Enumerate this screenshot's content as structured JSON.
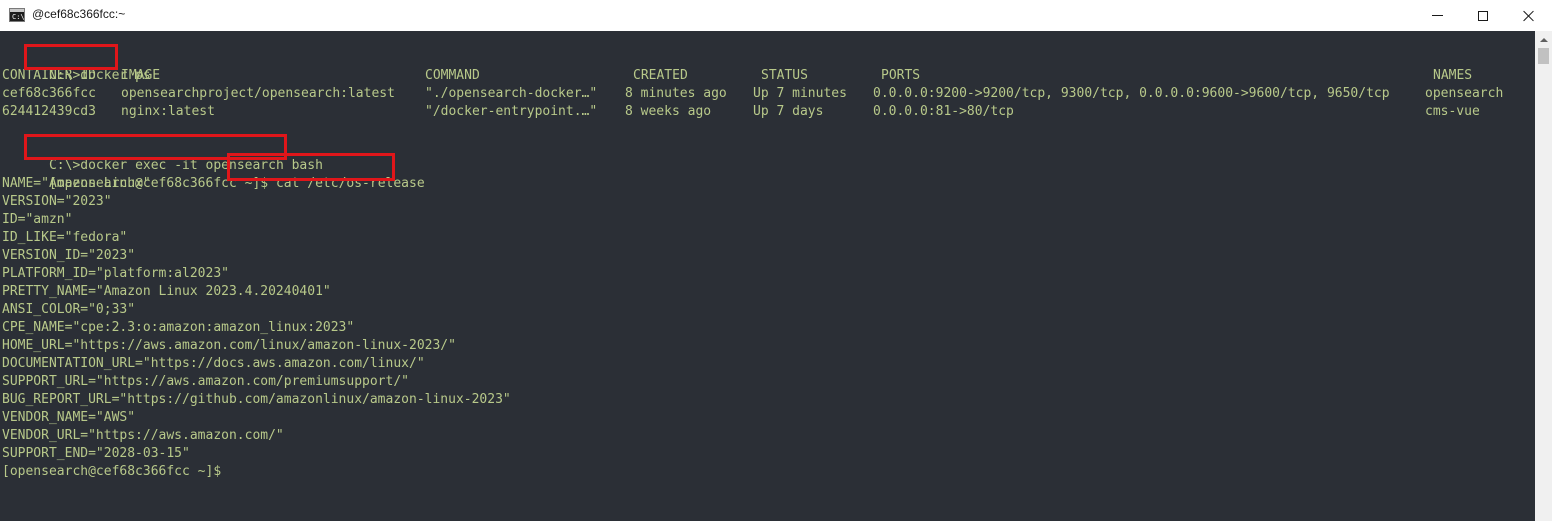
{
  "window": {
    "title": "@cef68c366fcc:~",
    "app_icon": "console-icon",
    "app_icon_glyph": "C:\\",
    "controls": {
      "minimize_icon": "minimize-icon",
      "maximize_icon": "maximize-icon",
      "close_icon": "close-icon"
    }
  },
  "terminal": {
    "colors": {
      "background": "#2b2f36",
      "text": "#b8c98a",
      "highlight_box": "#e0161a"
    },
    "commands": {
      "prompt1": "C:\\",
      "cmd1": ">docker ps",
      "prompt2": "C:\\",
      "cmd2": ">docker exec -it opensearch bash",
      "prompt3": "[opensearch@cef68c366fcc ~]$",
      "cmd3": " cat /etc/os-release",
      "final_prompt": "[opensearch@cef68c366fcc ~]$"
    },
    "docker_ps": {
      "headers": [
        "CONTAINER ID",
        "IMAGE",
        "COMMAND",
        "CREATED",
        "STATUS",
        "PORTS",
        "NAMES"
      ],
      "rows": [
        [
          "cef68c366fcc",
          "opensearchproject/opensearch:latest",
          "\"./opensearch-docker…\"",
          "8 minutes ago",
          "Up 7 minutes",
          "0.0.0.0:9200->9200/tcp, 9300/tcp, 0.0.0.0:9600->9600/tcp, 9650/tcp",
          "opensearch"
        ],
        [
          "624412439cd3",
          "nginx:latest",
          "\"/docker-entrypoint.…\"",
          "8 weeks ago",
          "Up 7 days",
          "0.0.0.0:81->80/tcp",
          "cms-vue"
        ]
      ]
    },
    "os_release": [
      "NAME=\"Amazon Linux\"",
      "VERSION=\"2023\"",
      "ID=\"amzn\"",
      "ID_LIKE=\"fedora\"",
      "VERSION_ID=\"2023\"",
      "PLATFORM_ID=\"platform:al2023\"",
      "PRETTY_NAME=\"Amazon Linux 2023.4.20240401\"",
      "ANSI_COLOR=\"0;33\"",
      "CPE_NAME=\"cpe:2.3:o:amazon:amazon_linux:2023\"",
      "HOME_URL=\"https://aws.amazon.com/linux/amazon-linux-2023/\"",
      "DOCUMENTATION_URL=\"https://docs.aws.amazon.com/linux/\"",
      "SUPPORT_URL=\"https://aws.amazon.com/premiumsupport/\"",
      "BUG_REPORT_URL=\"https://github.com/amazonlinux/amazon-linux-2023\"",
      "VENDOR_NAME=\"AWS\"",
      "VENDOR_URL=\"https://aws.amazon.com/\"",
      "SUPPORT_END=\"2028-03-15\""
    ]
  },
  "scrollbar": {
    "up_icon": "scroll-up-arrow-icon"
  }
}
